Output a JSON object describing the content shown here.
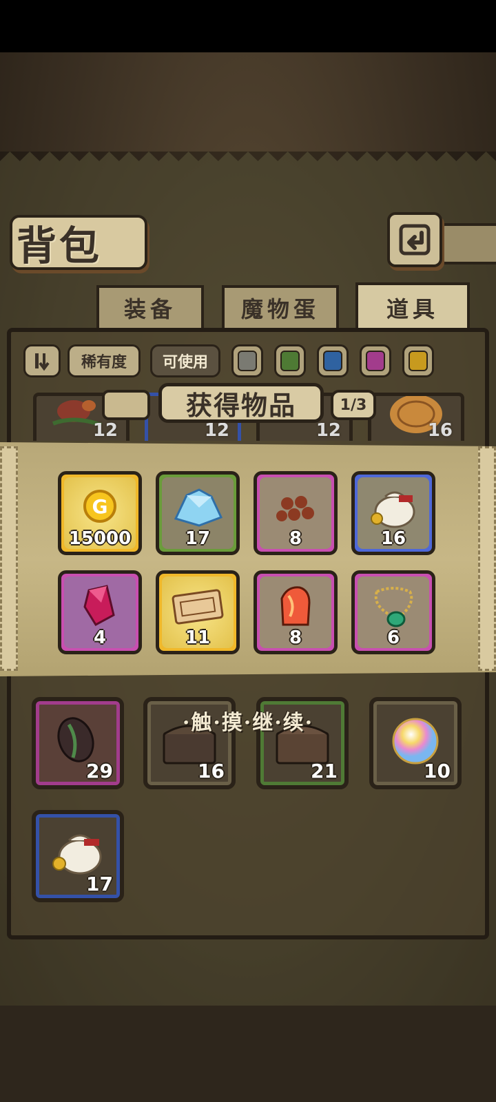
{
  "header": {
    "title": "背包",
    "back_icon": "back-arrow-icon"
  },
  "tabs": [
    {
      "label": "装备",
      "active": false
    },
    {
      "label": "魔物蛋",
      "active": false
    },
    {
      "label": "道具",
      "active": true
    }
  ],
  "filters": {
    "sort_icon": "sort-order-icon",
    "rarity_label": "稀有度",
    "usable_label": "可使用",
    "colors": [
      "#7a7a72",
      "#4e7a34",
      "#2f62a0",
      "#a23c8c",
      "#c79a1e"
    ]
  },
  "popup": {
    "title": "获得物品",
    "page": "1/3",
    "rewards": [
      {
        "name": "gold-coin",
        "count": "15000",
        "rarity": "gold"
      },
      {
        "name": "blue-crystal-cluster",
        "count": "17",
        "rarity": "green"
      },
      {
        "name": "brown-seeds",
        "count": "8",
        "rarity": "purple"
      },
      {
        "name": "coin-sack",
        "count": "16",
        "rarity": "blue"
      },
      {
        "name": "magenta-gem",
        "count": "4",
        "rarity": "purple"
      },
      {
        "name": "ticket",
        "count": "11",
        "rarity": "gold"
      },
      {
        "name": "fire-crystal",
        "count": "8",
        "rarity": "purple"
      },
      {
        "name": "jade-necklace",
        "count": "6",
        "rarity": "purple"
      }
    ]
  },
  "backpack": {
    "peek_counts": [
      "12",
      "12",
      "12",
      "16"
    ],
    "items": [
      {
        "name": "dark-seed",
        "count": "29",
        "frame": "purple"
      },
      {
        "name": "treasure-chest",
        "count": "16",
        "frame": "plain"
      },
      {
        "name": "treasure-chest",
        "count": "21",
        "frame": "green"
      },
      {
        "name": "rainbow-orb",
        "count": "10",
        "frame": "plain"
      },
      {
        "name": "coin-sack",
        "count": "17",
        "frame": "blue"
      }
    ]
  },
  "touch_continue": "·触·摸·继·续·"
}
